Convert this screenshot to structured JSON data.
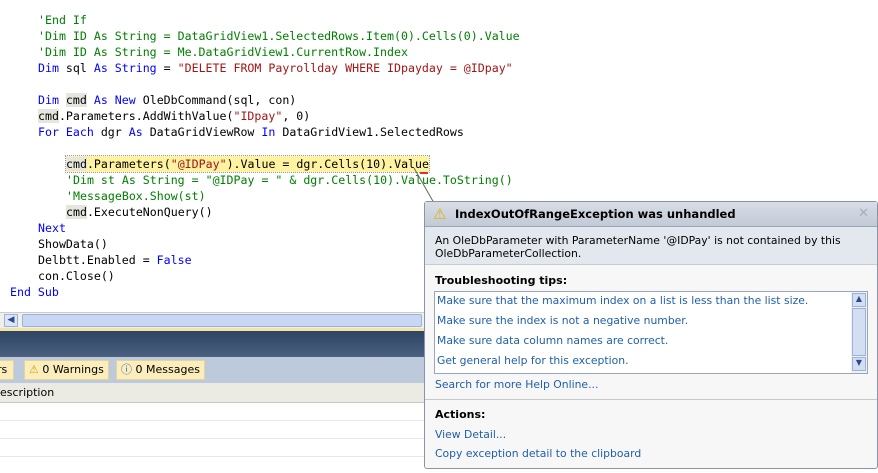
{
  "code": [
    {
      "indent": 38,
      "parts": [
        [
          "c",
          "'End If"
        ]
      ]
    },
    {
      "indent": 38,
      "parts": [
        [
          "c",
          "'Dim ID As String = DataGridView1.SelectedRows.Item(0).Cells(0).Value"
        ]
      ]
    },
    {
      "indent": 38,
      "parts": [
        [
          "c",
          "'Dim ID As String = Me.DataGridView1.CurrentRow.Index"
        ]
      ]
    },
    {
      "indent": 38,
      "parts": [
        [
          "k",
          "Dim"
        ],
        [
          "",
          "sql "
        ],
        [
          "k",
          "As String"
        ],
        [
          "",
          " = "
        ],
        [
          "s",
          "\"DELETE FROM Payrollday WHERE IDpayday = @IDpay\""
        ]
      ]
    },
    {
      "indent": 38,
      "parts": []
    },
    {
      "indent": 38,
      "parts": [
        [
          "k",
          "Dim "
        ],
        [
          "ref",
          "cmd"
        ],
        [
          "k",
          " As New"
        ],
        [
          "",
          " OleDbCommand(sql, con)"
        ]
      ]
    },
    {
      "indent": 38,
      "parts": [
        [
          "ref",
          "cmd"
        ],
        [
          "",
          ".Parameters.AddWithValue("
        ],
        [
          "s",
          "\"IDpay\""
        ],
        [
          "",
          ", 0)"
        ]
      ]
    },
    {
      "indent": 38,
      "parts": [
        [
          "k",
          "For Each"
        ],
        [
          "",
          " dgr "
        ],
        [
          "k",
          "As"
        ],
        [
          "",
          " DataGridViewRow "
        ],
        [
          "k",
          "In"
        ],
        [
          "",
          " DataGridView1.SelectedRows"
        ]
      ]
    },
    {
      "indent": 66,
      "parts": []
    },
    {
      "indent": 66,
      "hl": true,
      "parts": [
        [
          "ref",
          "cmd"
        ],
        [
          "",
          ".Parameters("
        ],
        [
          "s",
          "\"@IDPay\""
        ],
        [
          "",
          ").Value = dgr.Cells(10).Value"
        ]
      ]
    },
    {
      "indent": 66,
      "parts": [
        [
          "c",
          "'Dim st As String = \"@IDPay = \" & dgr.Cells(10).Value.ToString()"
        ]
      ]
    },
    {
      "indent": 66,
      "parts": [
        [
          "c",
          "'MessageBox.Show(st)"
        ]
      ]
    },
    {
      "indent": 66,
      "parts": [
        [
          "ref",
          "cmd"
        ],
        [
          "",
          ".ExecuteNonQuery()"
        ]
      ]
    },
    {
      "indent": 38,
      "parts": [
        [
          "k",
          "Next"
        ]
      ]
    },
    {
      "indent": 38,
      "parts": [
        [
          "",
          "ShowData()"
        ]
      ]
    },
    {
      "indent": 38,
      "parts": [
        [
          "",
          "Delbtt.Enabled = "
        ],
        [
          "k",
          "False"
        ]
      ]
    },
    {
      "indent": 38,
      "parts": [
        [
          "",
          "con.Close()"
        ]
      ]
    },
    {
      "indent": 10,
      "parts": [
        [
          "k",
          "End Sub"
        ]
      ]
    }
  ],
  "errorlist": {
    "errors_tab": "rs",
    "warnings_tab": "0 Warnings",
    "messages_tab": "0 Messages",
    "column_description": "escription"
  },
  "dialog": {
    "title": "IndexOutOfRangeException was unhandled",
    "message": "An OleDbParameter with ParameterName '@IDPay' is not contained by this OleDbParameterCollection.",
    "tips_heading": "Troubleshooting tips:",
    "tips": [
      "Make sure that the maximum index on a list is less than the list size.",
      "Make sure the index is not a negative number.",
      "Make sure data column names are correct.",
      "Get general help for this exception."
    ],
    "search_link": "Search for more Help Online...",
    "actions_heading": "Actions:",
    "actions": [
      "View Detail...",
      "Copy exception detail to the clipboard"
    ]
  }
}
